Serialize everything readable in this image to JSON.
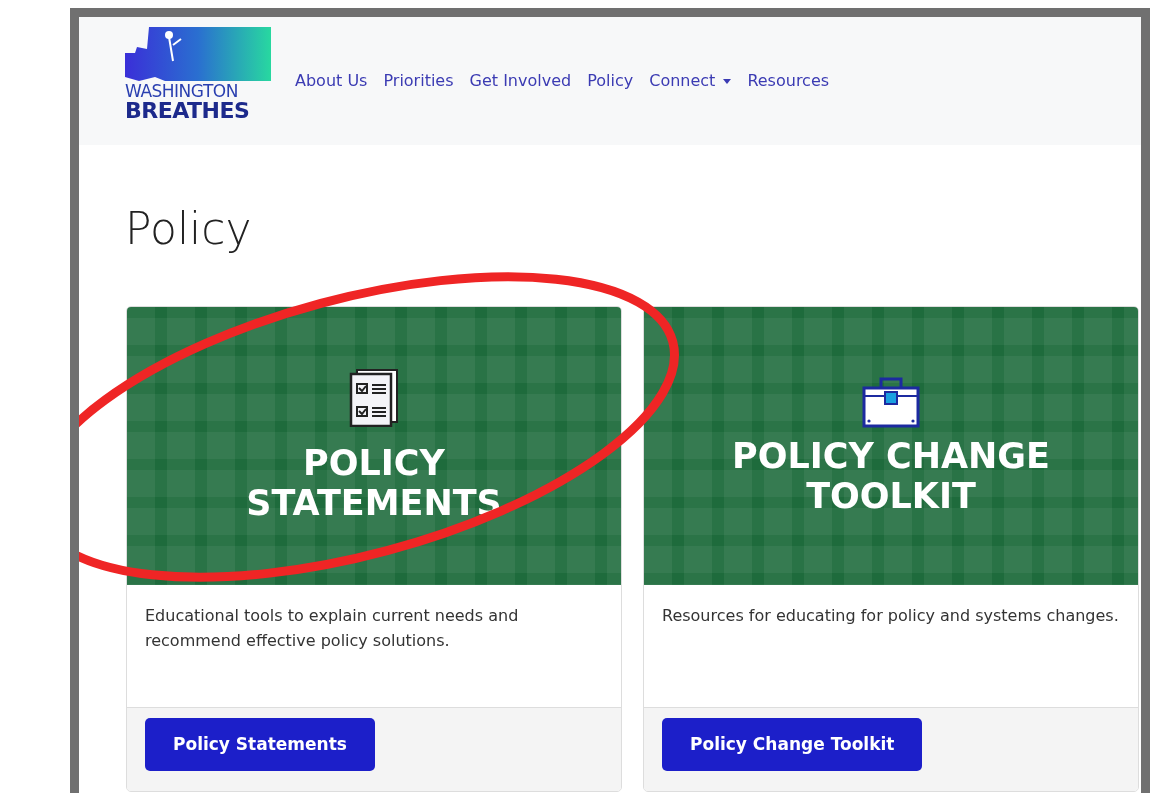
{
  "logo": {
    "line_1": "WASHINGTON",
    "line_2": "BREATHES"
  },
  "nav": [
    {
      "label": "About Us",
      "dropdown": false
    },
    {
      "label": "Priorities",
      "dropdown": false
    },
    {
      "label": "Get Involved",
      "dropdown": false
    },
    {
      "label": "Policy",
      "dropdown": false
    },
    {
      "label": "Connect",
      "dropdown": true
    },
    {
      "label": "Resources",
      "dropdown": false
    }
  ],
  "heading": "Policy",
  "cards": [
    {
      "kind": "checklist",
      "title_lines": [
        "POLICY",
        "STATEMENTS"
      ],
      "text": "Educational tools to explain current needs and recommend effective policy solutions.",
      "button": "Policy Statements"
    },
    {
      "kind": "toolbox",
      "title_lines": [
        "POLICY CHANGE",
        "TOOLKIT"
      ],
      "text": "Resources for educating for policy and systems changes.",
      "button": "Policy Change Toolkit"
    }
  ]
}
